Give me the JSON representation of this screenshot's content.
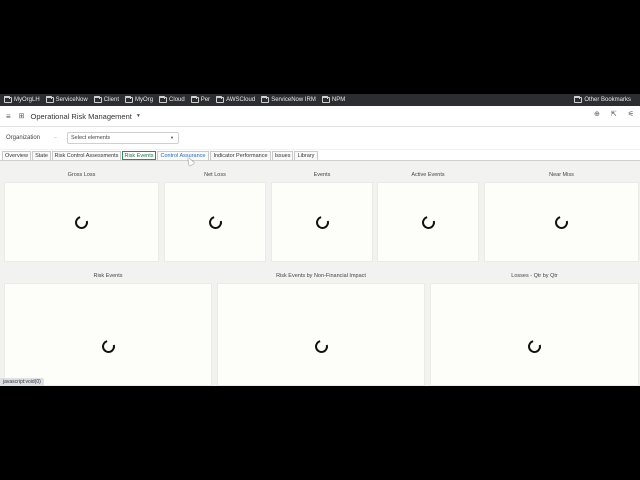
{
  "bookmarks": [
    {
      "label": "MyOrgLH",
      "icon": "folder-icon"
    },
    {
      "label": "ServiceNow",
      "icon": "folder-icon"
    },
    {
      "label": "Client",
      "icon": "folder-icon"
    },
    {
      "label": "MyOrg",
      "icon": "folder-icon"
    },
    {
      "label": "Cloud",
      "icon": "folder-icon"
    },
    {
      "label": "Per",
      "icon": "folder-icon"
    },
    {
      "label": "AWSCloud",
      "icon": "folder-icon"
    },
    {
      "label": "ServiceNow IRM",
      "icon": "folder-icon"
    },
    {
      "label": "NPM",
      "icon": "folder-icon"
    }
  ],
  "other_bookmarks": "Other Bookmarks",
  "app": {
    "title": "Operational Risk Management",
    "menu_icon": "hamburger-icon",
    "grid_icon": "grid-icon",
    "right_icons": [
      "add-circle-icon",
      "share-icon",
      "filter-settings-icon"
    ]
  },
  "filter": {
    "label": "Organization",
    "placeholder": "Select elements"
  },
  "tabs": [
    {
      "label": "Overview"
    },
    {
      "label": "State"
    },
    {
      "label": "Risk Control Assessments"
    },
    {
      "label": "Risk Events"
    },
    {
      "label": "Control Assurance"
    },
    {
      "label": "Indicator Performance"
    },
    {
      "label": "Issues"
    },
    {
      "label": "Library"
    }
  ],
  "active_tab": "Risk Events",
  "widgets_row1": [
    {
      "title": "Gross Loss"
    },
    {
      "title": "Net Loss"
    },
    {
      "title": "Events"
    },
    {
      "title": "Active Events"
    },
    {
      "title": "Near Miss"
    }
  ],
  "widgets_row2": [
    {
      "title": "Risk Events"
    },
    {
      "title": "Risk Events by Non-Financial Impact"
    },
    {
      "title": "Losses - Qtr by Qtr"
    }
  ],
  "status_text": "javascript:void(0)",
  "colors": {
    "active_tab_border": "#2e8b57",
    "bookmark_bar": "#2b2d30",
    "page_bg": "#f2f3f1"
  }
}
